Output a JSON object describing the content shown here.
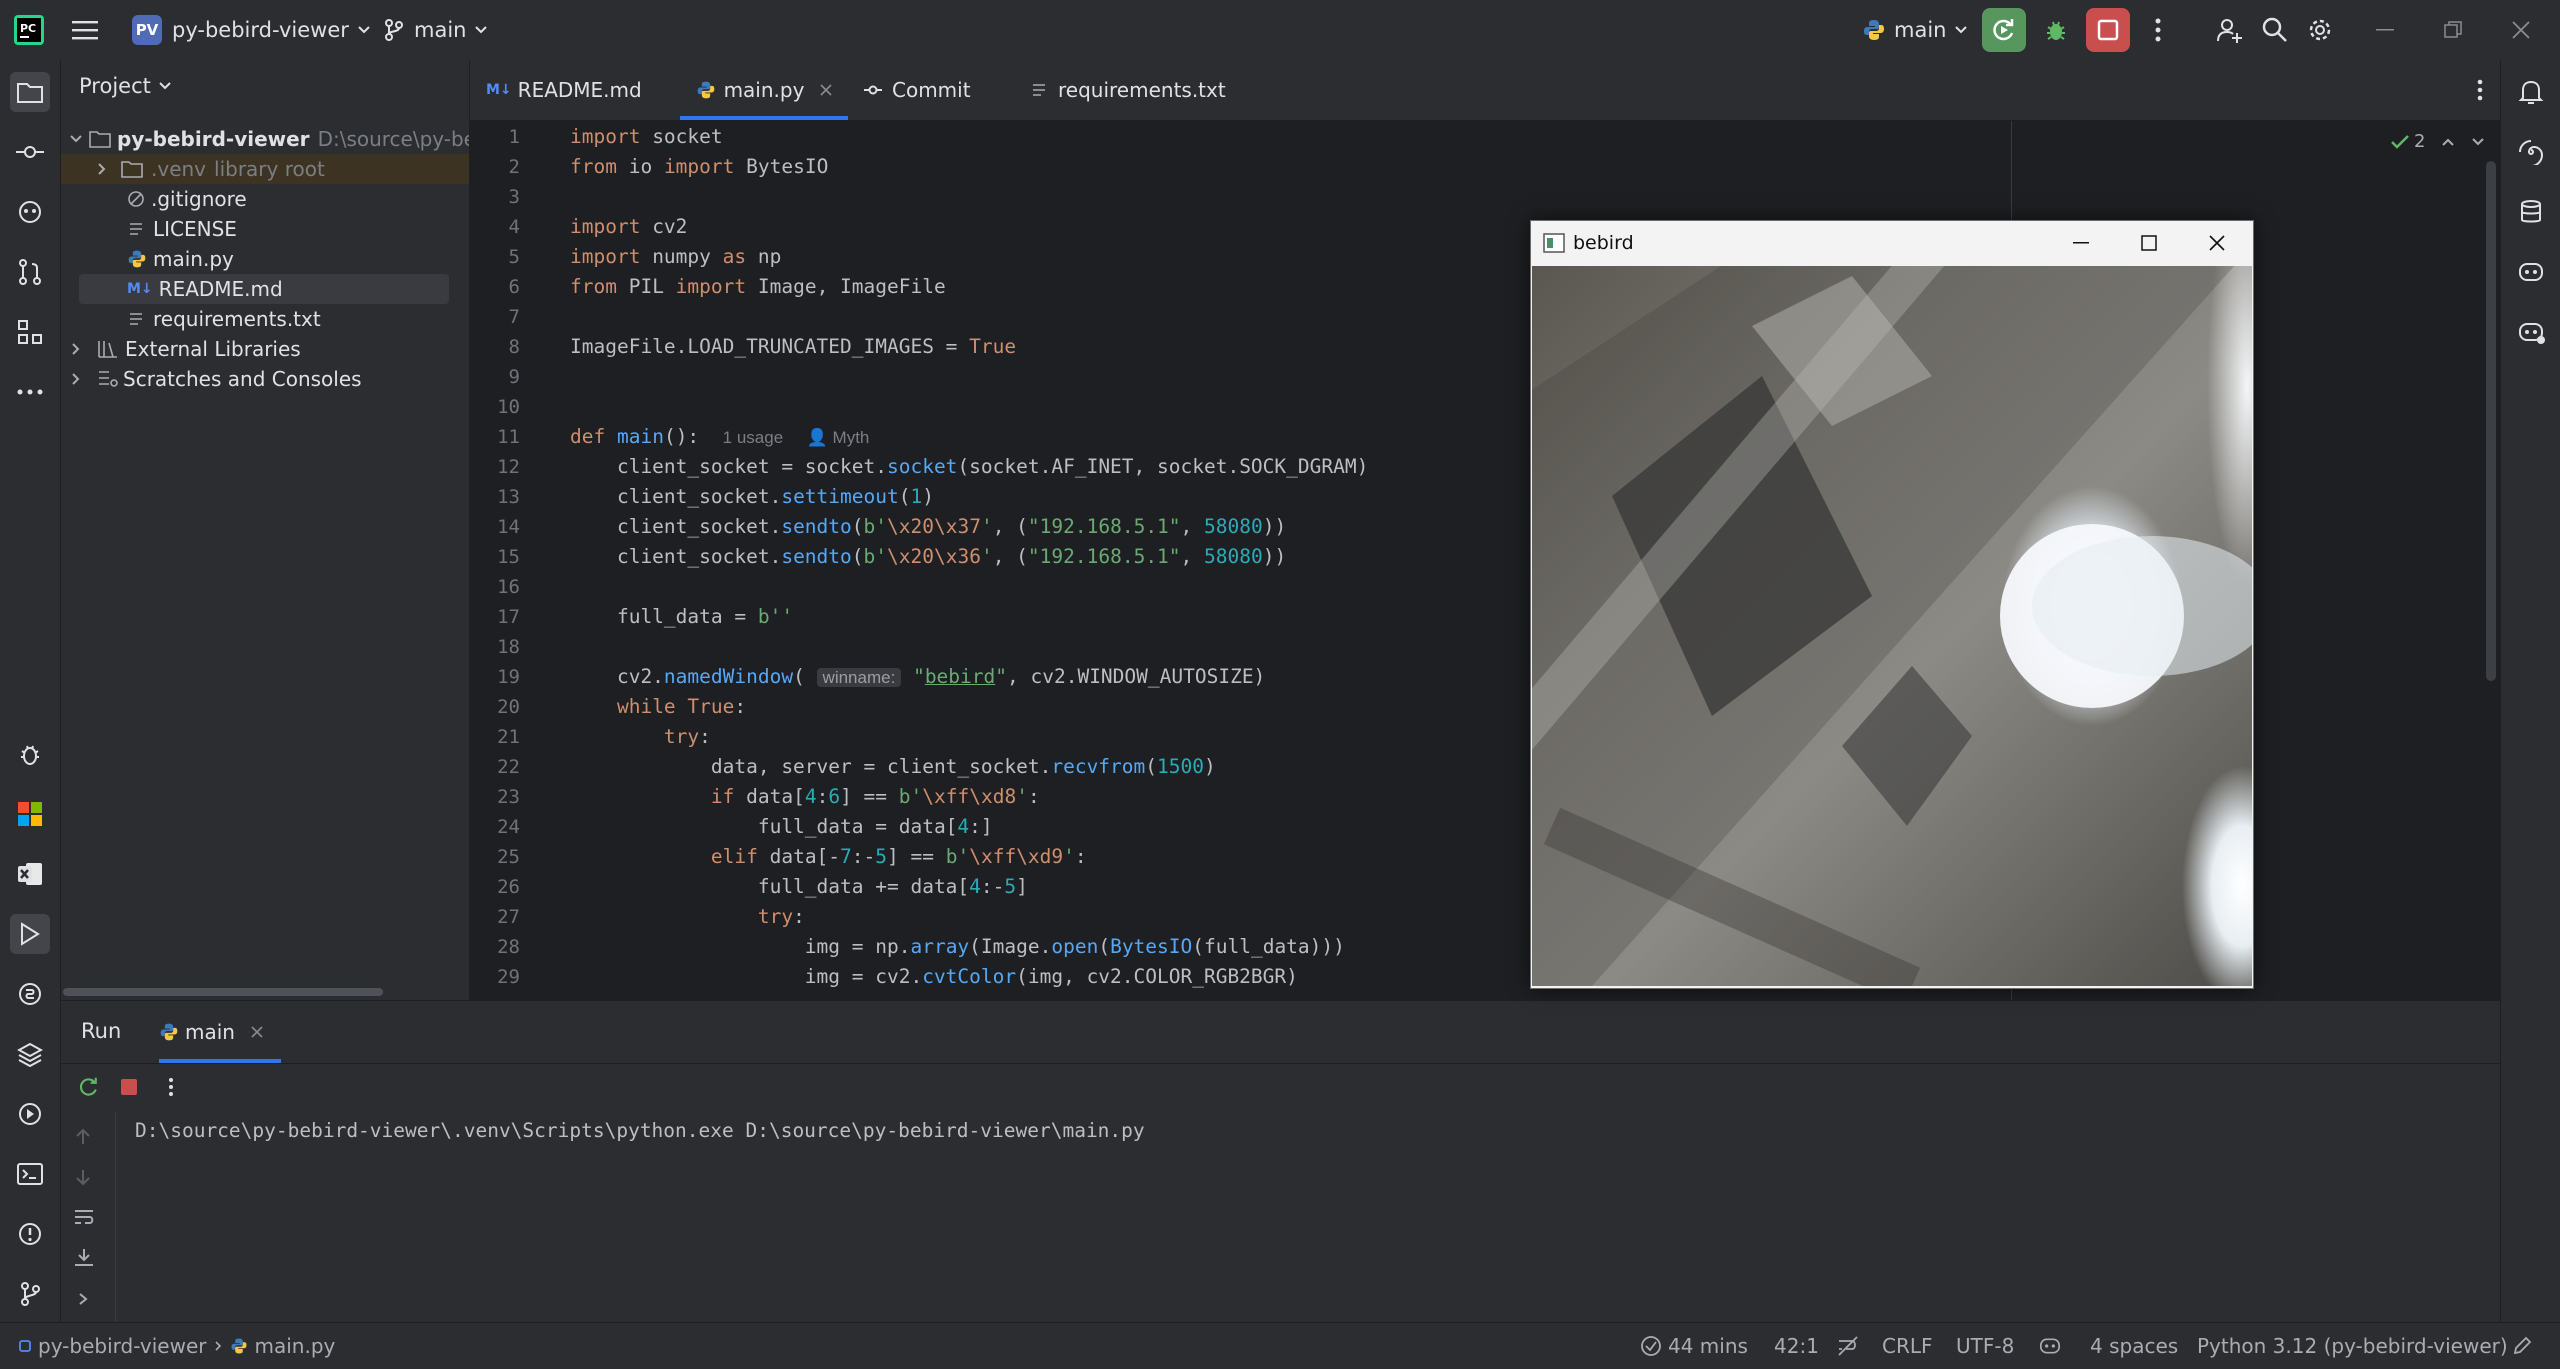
{
  "titlebar": {
    "project_badge": "PV",
    "project_name": "py-bebird-viewer",
    "branch": "main",
    "run_config": "main"
  },
  "project_panel": {
    "title": "Project",
    "tree": [
      {
        "label": "py-bebird-viewer",
        "hint": "D:\\source\\py-beb"
      },
      {
        "label": ".venv",
        "hint": "library root"
      },
      {
        "label": ".gitignore"
      },
      {
        "label": "LICENSE"
      },
      {
        "label": "main.py"
      },
      {
        "label": "README.md"
      },
      {
        "label": "requirements.txt"
      },
      {
        "label": "External Libraries"
      },
      {
        "label": "Scratches and Consoles"
      }
    ]
  },
  "tabs": [
    {
      "label": "README.md"
    },
    {
      "label": "main.py"
    },
    {
      "label": "Commit"
    },
    {
      "label": "requirements.txt"
    }
  ],
  "editor": {
    "problems_count": "2",
    "line_numbers": [
      "1",
      "2",
      "3",
      "4",
      "5",
      "6",
      "7",
      "8",
      "9",
      "10",
      "11",
      "12",
      "13",
      "14",
      "15",
      "16",
      "17",
      "18",
      "19",
      "20",
      "21",
      "22",
      "23",
      "24",
      "25",
      "26",
      "27",
      "28",
      "29"
    ],
    "usage_hint": "1 usage",
    "author_hint": "Myth",
    "param_hint": "winname:"
  },
  "floating_window": {
    "title": "bebird"
  },
  "run_panel": {
    "title": "Run",
    "tab": "main",
    "command": "D:\\source\\py-bebird-viewer\\.venv\\Scripts\\python.exe D:\\source\\py-bebird-viewer\\main.py"
  },
  "statusbar": {
    "breadcrumb_project": "py-bebird-viewer",
    "breadcrumb_file": "main.py",
    "time": "44 mins",
    "position": "42:1",
    "line_sep": "CRLF",
    "encoding": "UTF-8",
    "indent": "4 spaces",
    "interpreter": "Python 3.12 (py-bebird-viewer)"
  },
  "colors": {
    "accent": "#3574f0",
    "run_green": "#57965c",
    "stop_red": "#c94f4f"
  }
}
